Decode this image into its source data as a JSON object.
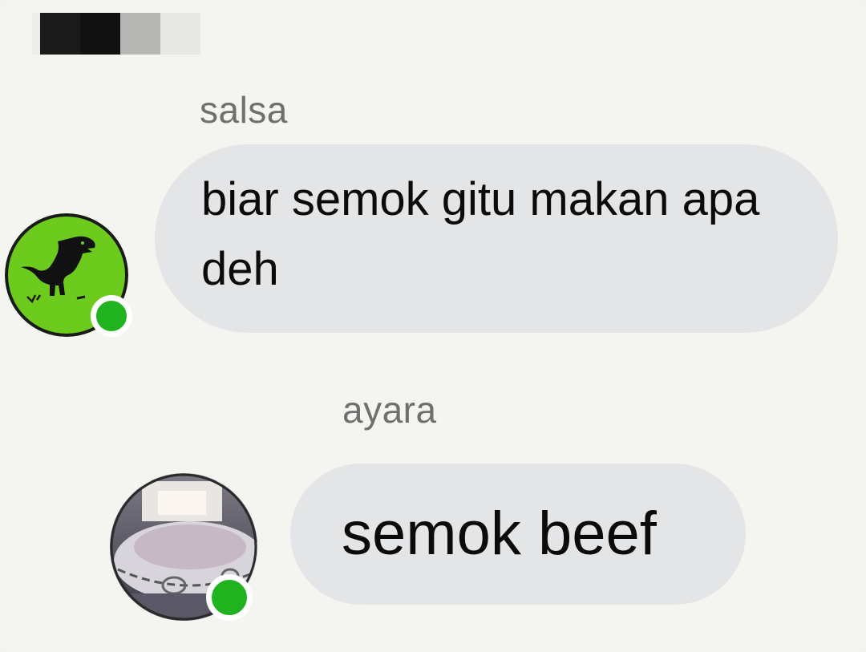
{
  "messages": [
    {
      "sender": "salsa",
      "text": "biar semok gitu makan apa deh",
      "avatar_icon": "dinosaur-icon",
      "avatar_color": "#6dcb1e",
      "online": true
    },
    {
      "sender": "ayara",
      "text": "semok beef",
      "avatar_icon": "robot-toy-photo",
      "online": true
    }
  ],
  "colors": {
    "bubble": "#e4e5e7",
    "sender_text": "#6f6f6f",
    "online_dot": "#21b21f",
    "background": "#f4f4f0"
  }
}
